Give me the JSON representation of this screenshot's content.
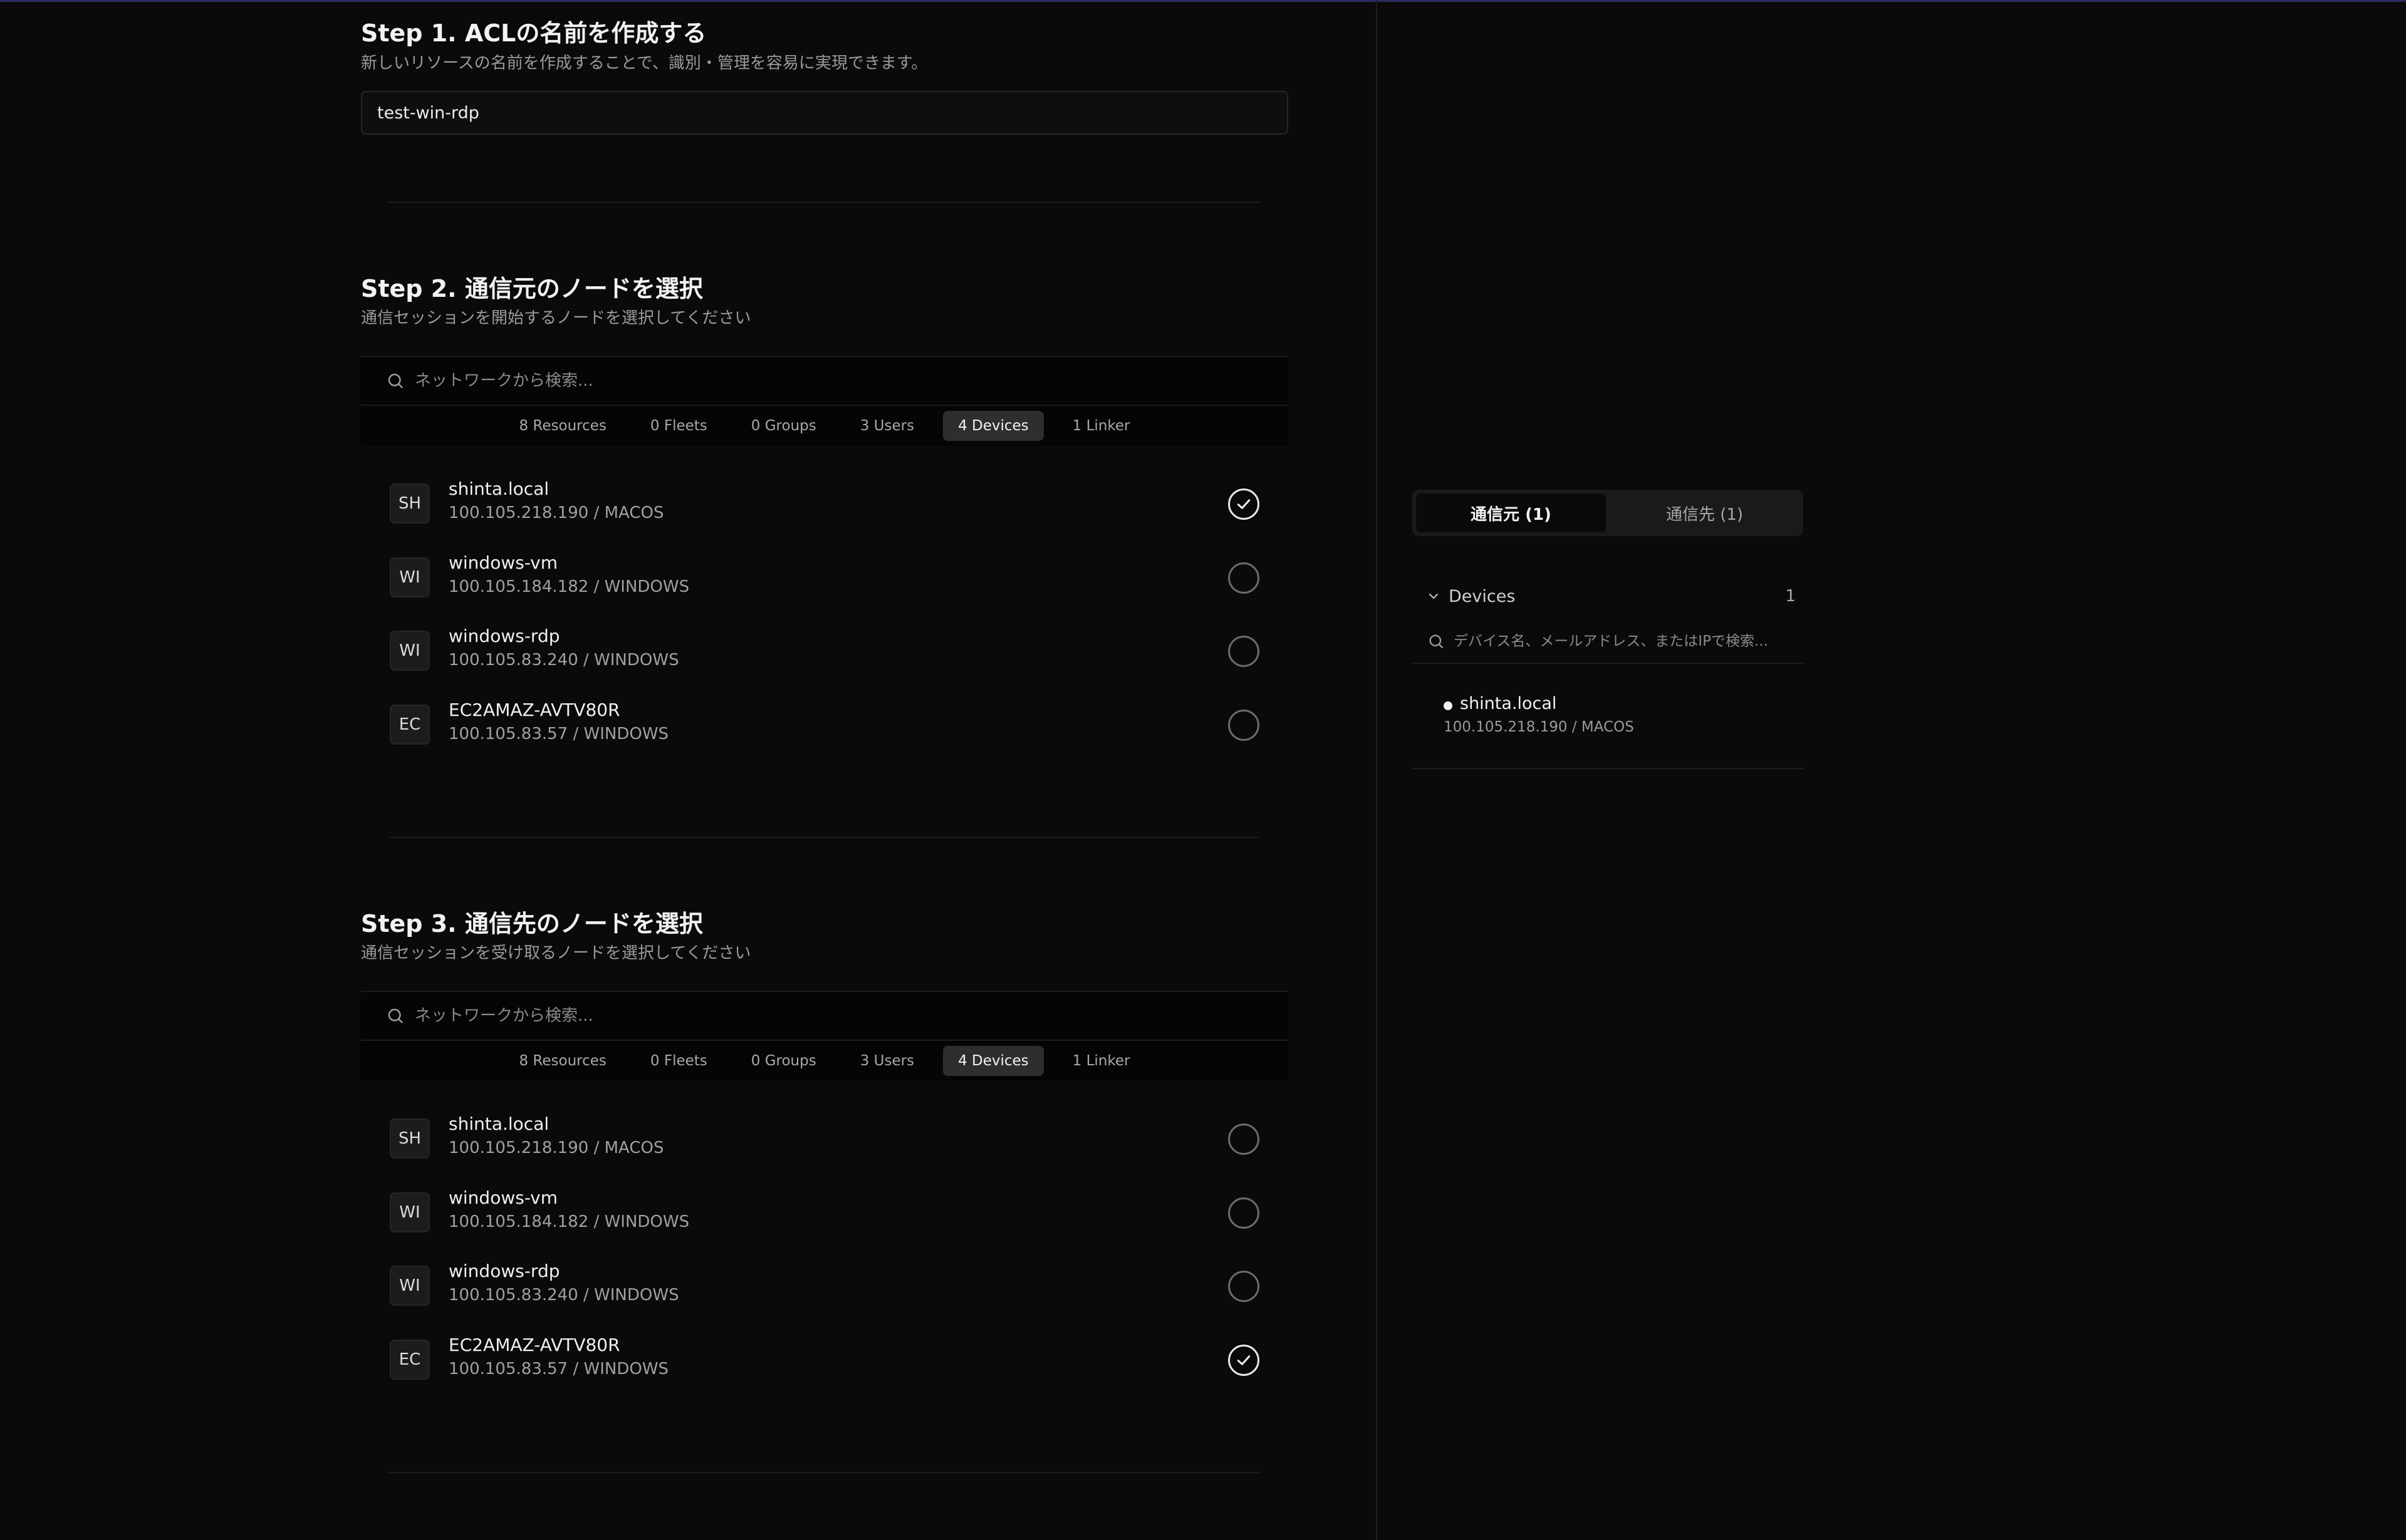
{
  "step1": {
    "title": "Step 1. ACLの名前を作成する",
    "desc": "新しいリソースの名前を作成することで、識別・管理を容易に実現できます。",
    "name_value": "test-win-rdp"
  },
  "step2": {
    "title": "Step 2. 通信元のノードを選択",
    "desc": "通信セッションを開始するノードを選択してください",
    "search_placeholder": "ネットワークから検索...",
    "tabs": [
      "8 Resources",
      "0 Fleets",
      "0 Groups",
      "3 Users",
      "4 Devices",
      "1 Linker"
    ],
    "active_tab": "4 Devices",
    "devices": [
      {
        "badge": "SH",
        "name": "shinta.local",
        "meta": "100.105.218.190 / MACOS",
        "selected": true
      },
      {
        "badge": "WI",
        "name": "windows-vm",
        "meta": "100.105.184.182 / WINDOWS",
        "selected": false
      },
      {
        "badge": "WI",
        "name": "windows-rdp",
        "meta": "100.105.83.240 / WINDOWS",
        "selected": false
      },
      {
        "badge": "EC",
        "name": "EC2AMAZ-AVTV80R",
        "meta": "100.105.83.57 / WINDOWS",
        "selected": false
      }
    ]
  },
  "step3": {
    "title": "Step 3. 通信先のノードを選択",
    "desc": "通信セッションを受け取るノードを選択してください",
    "search_placeholder": "ネットワークから検索...",
    "tabs": [
      "8 Resources",
      "0 Fleets",
      "0 Groups",
      "3 Users",
      "4 Devices",
      "1 Linker"
    ],
    "active_tab": "4 Devices",
    "devices": [
      {
        "badge": "SH",
        "name": "shinta.local",
        "meta": "100.105.218.190 / MACOS",
        "selected": false
      },
      {
        "badge": "WI",
        "name": "windows-vm",
        "meta": "100.105.184.182 / WINDOWS",
        "selected": false
      },
      {
        "badge": "WI",
        "name": "windows-rdp",
        "meta": "100.105.83.240 / WINDOWS",
        "selected": false
      },
      {
        "badge": "EC",
        "name": "EC2AMAZ-AVTV80R",
        "meta": "100.105.83.57 / WINDOWS",
        "selected": true
      }
    ]
  },
  "aside": {
    "seg_source": "通信元 (1)",
    "seg_dest": "通信先 (1)",
    "group_label": "Devices",
    "group_count": "1",
    "search_placeholder": "デバイス名、メールアドレス、またはIPで検索...",
    "selected": {
      "name": "shinta.local",
      "meta": "100.105.218.190 / MACOS"
    }
  },
  "icons": {
    "search": "search-icon",
    "check": "check-icon",
    "chevron": "chevron-down-icon"
  }
}
